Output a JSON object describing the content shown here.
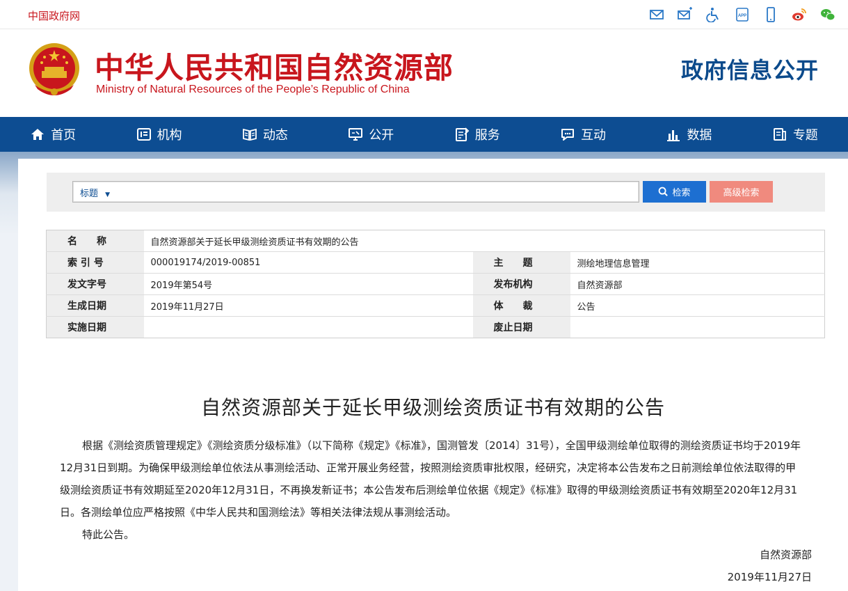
{
  "topbar": {
    "gov_link": "中国政府网",
    "icons": [
      "mail-icon",
      "subscribe-mail-icon",
      "accessibility-icon",
      "app-icon",
      "mobile-icon",
      "weibo-icon",
      "wechat-icon"
    ]
  },
  "header": {
    "title": "中华人民共和国自然资源部",
    "subtitle": "Ministry of Natural Resources of the People’s Republic of China",
    "section": "政府信息公开"
  },
  "nav": {
    "items": [
      {
        "label": "首页",
        "icon": "home-icon"
      },
      {
        "label": "机构",
        "icon": "org-icon"
      },
      {
        "label": "动态",
        "icon": "news-icon"
      },
      {
        "label": "公开",
        "icon": "disclosure-icon"
      },
      {
        "label": "服务",
        "icon": "service-icon"
      },
      {
        "label": "互动",
        "icon": "chat-icon"
      },
      {
        "label": "数据",
        "icon": "chart-icon"
      },
      {
        "label": "专题",
        "icon": "topic-icon"
      }
    ]
  },
  "search": {
    "field": "标题",
    "button": "检索",
    "advanced": "高级检索",
    "value": ""
  },
  "meta": {
    "name_label": "名　　称",
    "name_value": "自然资源部关于延长甲级测绘资质证书有效期的公告",
    "index_label": "索 引 号",
    "index_value": "000019174/2019-00851",
    "topic_label": "主　　题",
    "topic_value": "测绘地理信息管理",
    "docno_label": "发文字号",
    "docno_value": "2019年第54号",
    "org_label": "发布机构",
    "org_value": "自然资源部",
    "gen_label": "生成日期",
    "gen_value": "2019年11月27日",
    "genre_label": "体　　裁",
    "genre_value": "公告",
    "impl_label": "实施日期",
    "impl_value": "",
    "abol_label": "废止日期",
    "abol_value": ""
  },
  "article": {
    "title": "自然资源部关于延长甲级测绘资质证书有效期的公告",
    "paragraph1": "根据《测绘资质管理规定》《测绘资质分级标准》（以下简称《规定》《标准》，国测管发〔2014〕31号），全国甲级测绘单位取得的测绘资质证书均于2019年12月31日到期。为确保甲级测绘单位依法从事测绘活动、正常开展业务经营，按照测绘资质审批权限，经研究，决定将本公告发布之日前测绘单位依法取得的甲级测绘资质证书有效期延至2020年12月31日，不再换发新证书；本公告发布后测绘单位依据《规定》《标准》取得的甲级测绘资质证书有效期至2020年12月31日。各测绘单位应严格按照《中华人民共和国测绘法》等相关法律法规从事测绘活动。",
    "paragraph2": "特此公告。",
    "signature": "自然资源部",
    "date": "2019年11月27日"
  },
  "colors": {
    "brand_red": "#c8161d",
    "nav_blue": "#0d4d92",
    "search_blue": "#1d6fd1",
    "adv_salmon": "#f08a7e"
  }
}
